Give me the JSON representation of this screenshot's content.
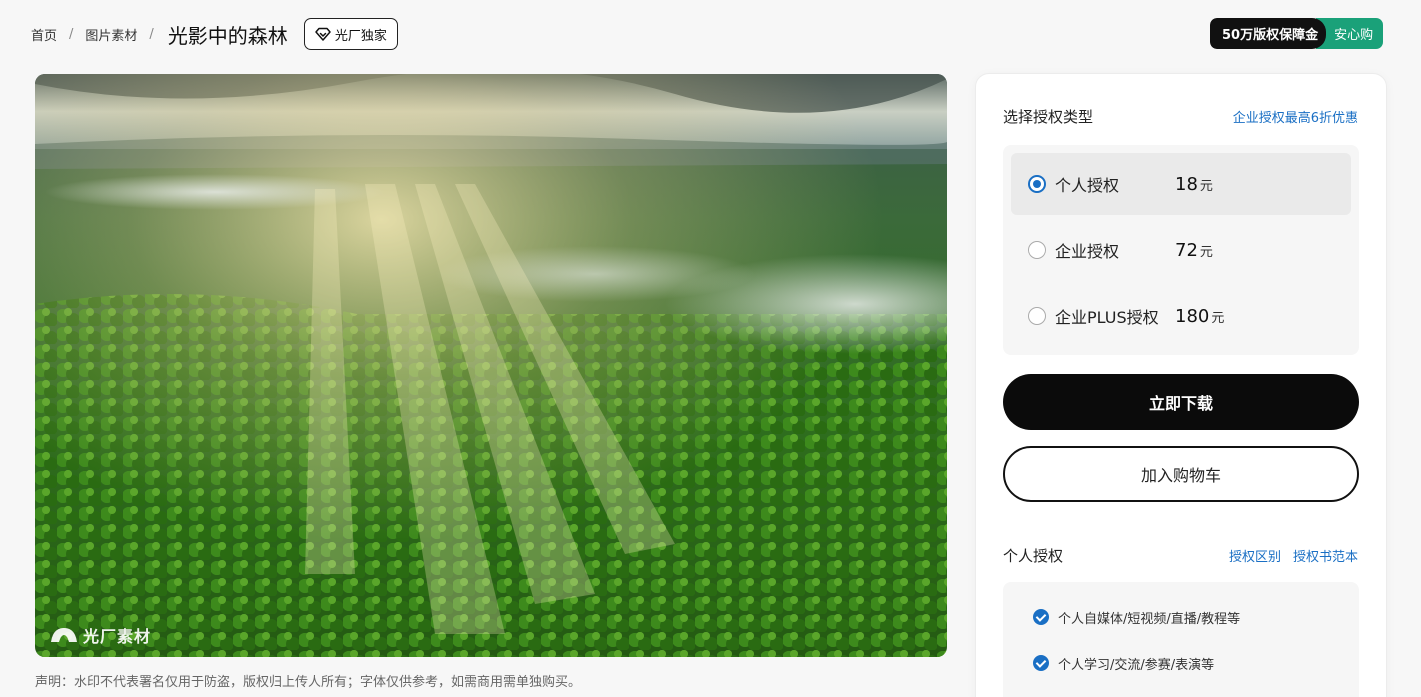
{
  "breadcrumb": {
    "home": "首页",
    "category": "图片素材",
    "separator": "/",
    "title": "光影中的森林"
  },
  "badge": {
    "label": "光厂独家",
    "icon": "diamond-icon"
  },
  "guarantee": {
    "left": "50万版权保障金",
    "right": "安心购"
  },
  "watermark": {
    "text": "光厂素材",
    "icon": "logo-icon"
  },
  "disclaimer": "声明：水印不代表署名仅用于防盗，版权归上传人所有；字体仅供参考，如需商用需单独购买。",
  "license": {
    "heading": "选择授权类型",
    "promo": "企业授权最高6折优惠",
    "options": [
      {
        "name": "个人授权",
        "price": "18",
        "unit": "元",
        "selected": true
      },
      {
        "name": "企业授权",
        "price": "72",
        "unit": "元",
        "selected": false
      },
      {
        "name": "企业PLUS授权",
        "price": "180",
        "unit": "元",
        "selected": false
      }
    ]
  },
  "actions": {
    "download": "立即下载",
    "cart": "加入购物车"
  },
  "scope": {
    "heading": "个人授权",
    "link1": "授权区别",
    "link2": "授权书范本",
    "features": [
      "个人自媒体/短视频/直播/教程等",
      "个人学习/交流/参赛/表演等"
    ]
  },
  "colors": {
    "accent": "#1a6fc4",
    "green": "#1aa179",
    "dark": "#0b0b0b"
  }
}
